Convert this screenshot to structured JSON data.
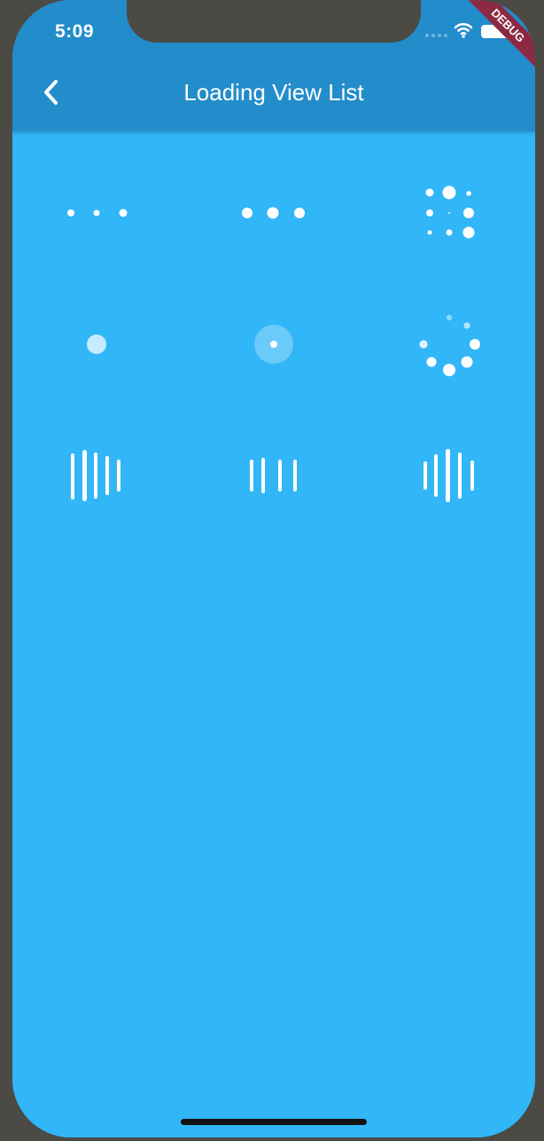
{
  "status_bar": {
    "time": "5:09",
    "icons": [
      "signal-icon",
      "wifi-icon",
      "battery-icon"
    ]
  },
  "header": {
    "title": "Loading View List",
    "back_icon": "chevron-left-icon"
  },
  "debug_banner": {
    "label": "DEBUG"
  },
  "loaders": [
    {
      "name": "three-bouncing-dots"
    },
    {
      "name": "three-pulse-dots"
    },
    {
      "name": "dot-spinner-grid"
    },
    {
      "name": "single-dot"
    },
    {
      "name": "ripple-dot"
    },
    {
      "name": "circular-dot-spinner"
    },
    {
      "name": "bars-large"
    },
    {
      "name": "bars-small"
    },
    {
      "name": "bars-wave"
    }
  ],
  "colors": {
    "app_bar": "#238dcb",
    "background": "#31b6f8",
    "foreground": "#ffffff",
    "debug": "#8c2943"
  }
}
